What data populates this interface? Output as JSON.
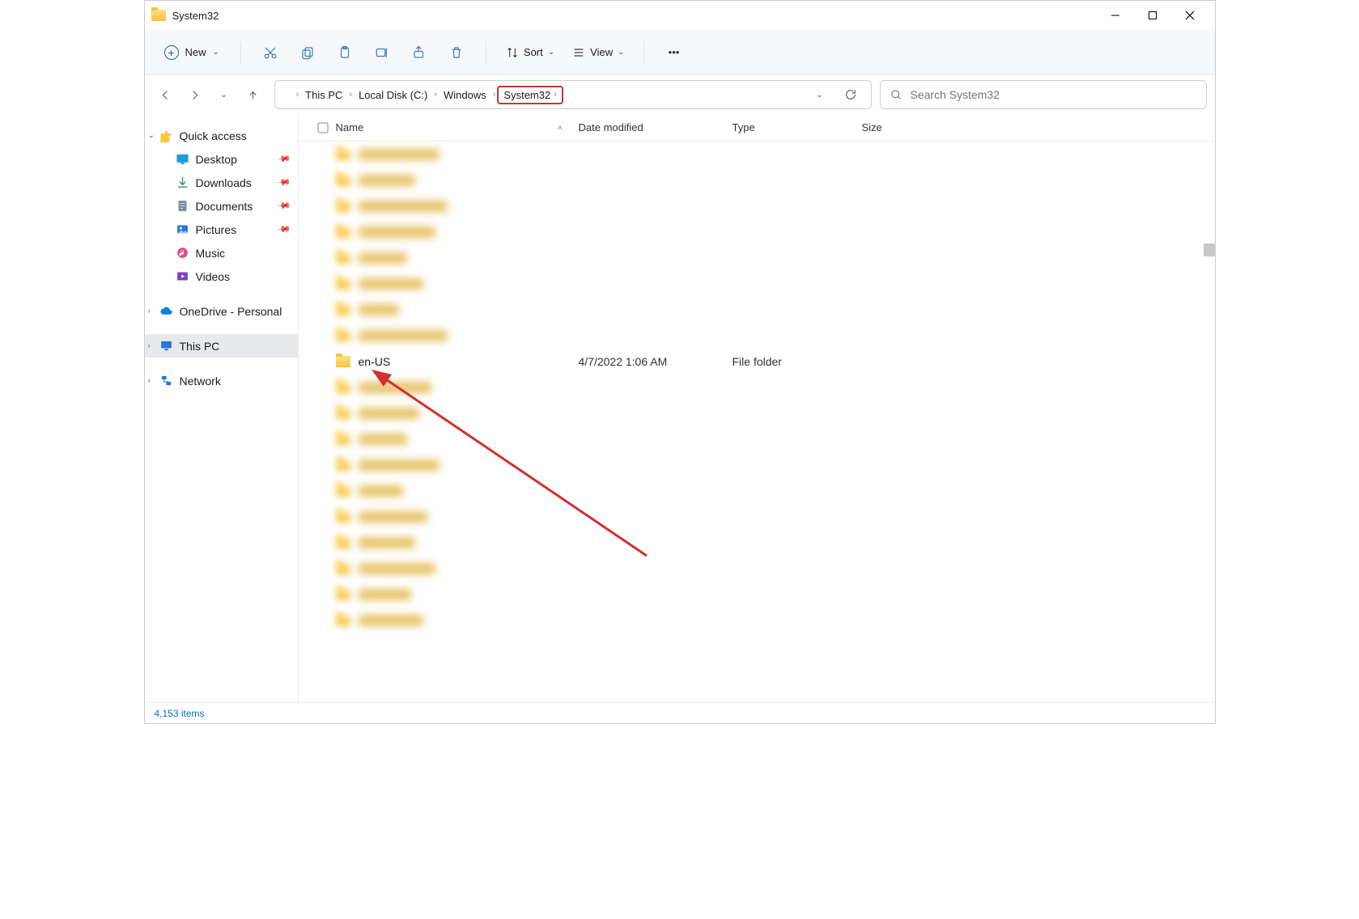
{
  "window": {
    "title": "System32"
  },
  "toolbar": {
    "new_label": "New",
    "sort_label": "Sort",
    "view_label": "View"
  },
  "breadcrumb": [
    {
      "label": "This PC"
    },
    {
      "label": "Local Disk (C:)"
    },
    {
      "label": "Windows"
    },
    {
      "label": "System32",
      "highlighted": true
    }
  ],
  "search": {
    "placeholder": "Search System32"
  },
  "sidebar": {
    "quick_access": "Quick access",
    "items": [
      {
        "label": "Desktop",
        "pinned": true
      },
      {
        "label": "Downloads",
        "pinned": true
      },
      {
        "label": "Documents",
        "pinned": true
      },
      {
        "label": "Pictures",
        "pinned": true
      },
      {
        "label": "Music",
        "pinned": false
      },
      {
        "label": "Videos",
        "pinned": false
      }
    ],
    "onedrive": "OneDrive - Personal",
    "this_pc": "This PC",
    "network": "Network"
  },
  "columns": {
    "name": "Name",
    "date": "Date modified",
    "type": "Type",
    "size": "Size"
  },
  "files": {
    "visible_row": {
      "name": "en-US",
      "date": "4/7/2022 1:06 AM",
      "type": "File folder"
    }
  },
  "status": {
    "items": "4,153 items"
  },
  "annotation": {
    "highlight_crumb": "System32",
    "arrow_target": "en-US"
  }
}
